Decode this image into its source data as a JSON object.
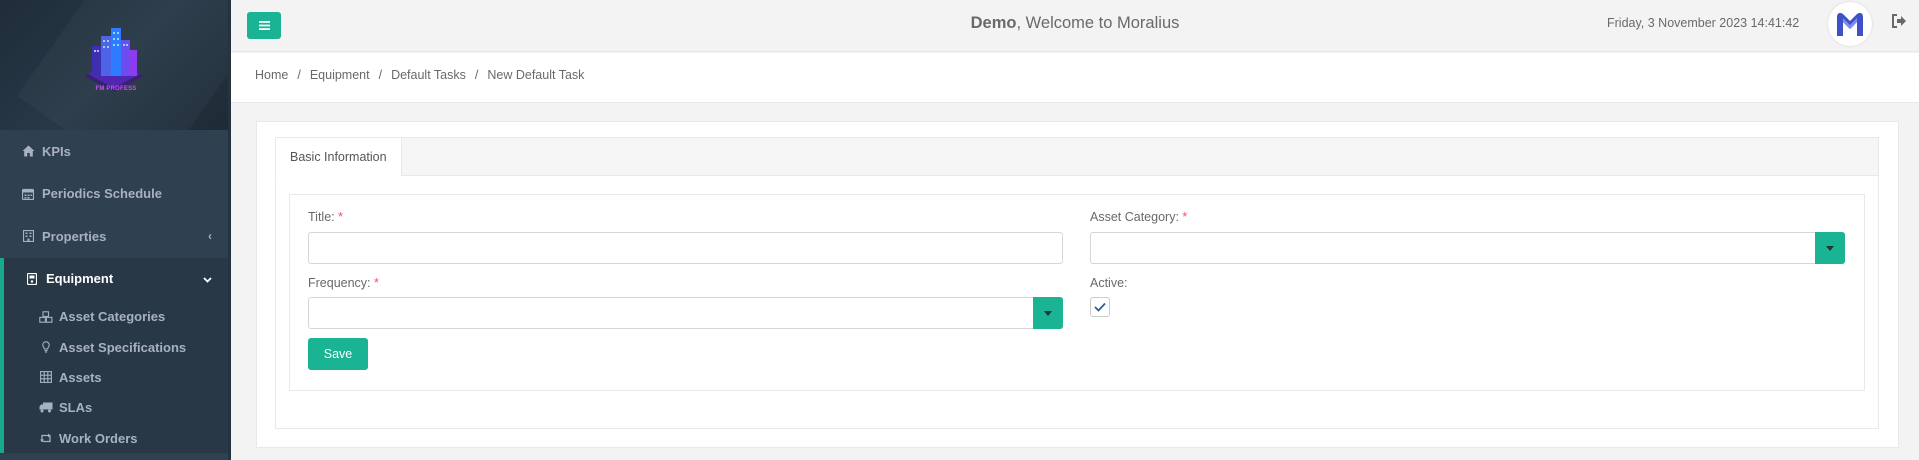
{
  "logo": {
    "caption": "FM PROFESS"
  },
  "sidebar": {
    "items": [
      {
        "label": "KPIs",
        "icon": "home-icon"
      },
      {
        "label": "Periodics Schedule",
        "icon": "calendar-icon"
      },
      {
        "label": "Properties",
        "icon": "building-icon"
      },
      {
        "label": "Equipment",
        "icon": "device-icon"
      }
    ],
    "sub_items": [
      {
        "label": "Asset Categories",
        "icon": "cubes-icon"
      },
      {
        "label": "Asset Specifications",
        "icon": "lightbulb-icon"
      },
      {
        "label": "Assets",
        "icon": "grid-icon"
      },
      {
        "label": "SLAs",
        "icon": "truck-icon"
      },
      {
        "label": "Work Orders",
        "icon": "retweet-icon"
      }
    ]
  },
  "header": {
    "welcome_bold": "Demo",
    "welcome_rest": ", Welcome to Moralius",
    "datetime": "Friday, 3 November 2023 14:41:42"
  },
  "breadcrumb": {
    "items": [
      "Home",
      "Equipment",
      "Default Tasks"
    ],
    "current": "New Default Task",
    "separator": "/"
  },
  "form": {
    "tab_label": "Basic Information",
    "title_label": "Title:",
    "title_value": "",
    "asset_category_label": "Asset Category:",
    "asset_category_value": "",
    "frequency_label": "Frequency:",
    "frequency_value": "",
    "active_label": "Active:",
    "active_checked": true,
    "required_marker": "*",
    "save_label": "Save"
  },
  "colors": {
    "accent": "#1ab394",
    "sidebar_bg": "#2f4050",
    "required": "#ed5565"
  }
}
